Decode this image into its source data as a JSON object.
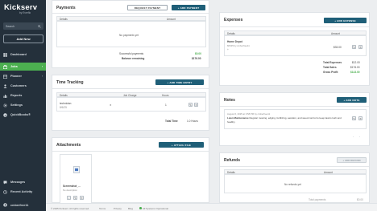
{
  "sidebar": {
    "brand": "Kickserv",
    "brand_by": "by Everflo",
    "search_placeholder": "Search",
    "add_new": "Add New",
    "items": [
      {
        "label": "Dashboard",
        "icon": "dashboard-icon"
      },
      {
        "label": "Jobs",
        "icon": "jobs-icon",
        "active": true
      },
      {
        "label": "Planner",
        "icon": "planner-icon"
      },
      {
        "label": "Customers",
        "icon": "customers-icon"
      },
      {
        "label": "Reports",
        "icon": "reports-icon"
      },
      {
        "label": "Settings",
        "icon": "settings-icon"
      },
      {
        "label": "QuickBooks®",
        "icon": "quickbooks-icon"
      },
      {
        "label": "Messages",
        "icon": "messages-icon"
      },
      {
        "label": "Recent Activity",
        "icon": "recent-activity-icon"
      }
    ],
    "user": "cmberfree11"
  },
  "payments": {
    "title": "Payments",
    "request_btn": "REQUEST PAYMENT",
    "add_btn": "+ ADD PAYMENT",
    "col_details": "Details",
    "col_amount": "Amount",
    "empty": "No payments yet",
    "successful_label": "Successful payments",
    "successful_value": "$0.00",
    "balance_label": "Balance remaining",
    "balance_value": "$176.00"
  },
  "time_tracking": {
    "title": "Time Tracking",
    "add_btn": "+ ADD TIME ENTRY",
    "col_details": "Details",
    "col_job_charge": "Job Charge",
    "col_hours": "Hours",
    "row_name": "technician",
    "row_date": "8/6/25",
    "row_charge": "✕",
    "row_hours": "1",
    "total_label": "Total Time",
    "total_value": "1.0 Hours"
  },
  "attachments": {
    "title": "Attachments",
    "add_btn": "+ ATTACH FILE",
    "file_name": "Screenshot_...",
    "file_desc": "No description"
  },
  "expenses": {
    "title": "Expenses",
    "add_btn": "+ ADD EXPENSE",
    "col_details": "Details",
    "col_amount": "Amount",
    "row_name": "Home Depot",
    "row_sub": "8/6/25 by cmberfree11",
    "row_amount": "$33.00",
    "total_expenses_label": "Total Expenses",
    "total_expenses_value": "$12.00",
    "total_sales_label": "Total Sales",
    "total_sales_value": "$176.00",
    "gross_profit_label": "Gross Profit",
    "gross_profit_value": "$143.00"
  },
  "notes": {
    "title": "Notes",
    "add_btn": "+ ADD NOTE",
    "note_meta": "August 6, 2025 at 3:58 PM by cmberfree11",
    "note_title": "Lawn Maintenance",
    "note_text": " Regular mowing, edging, fertilizing, aeration, and weed control to keep lawns lush and healthy."
  },
  "refunds": {
    "title": "Refunds",
    "add_btn": "+ ADD REFUND",
    "col_details": "Details",
    "col_amount": "Amount",
    "empty": "No refunds yet",
    "total_label": "Total payments",
    "total_value": "$0.00"
  },
  "footer": {
    "copyright": "© 2025 Kickserv. All rights reserved.",
    "terms": "Terms",
    "privacy": "Privacy",
    "blog": "Blog",
    "status": "All Systems Operational"
  },
  "colors": {
    "sidebar_bg": "#24303b",
    "active_green": "#4caf50",
    "button_dark": "#1f5f78"
  }
}
